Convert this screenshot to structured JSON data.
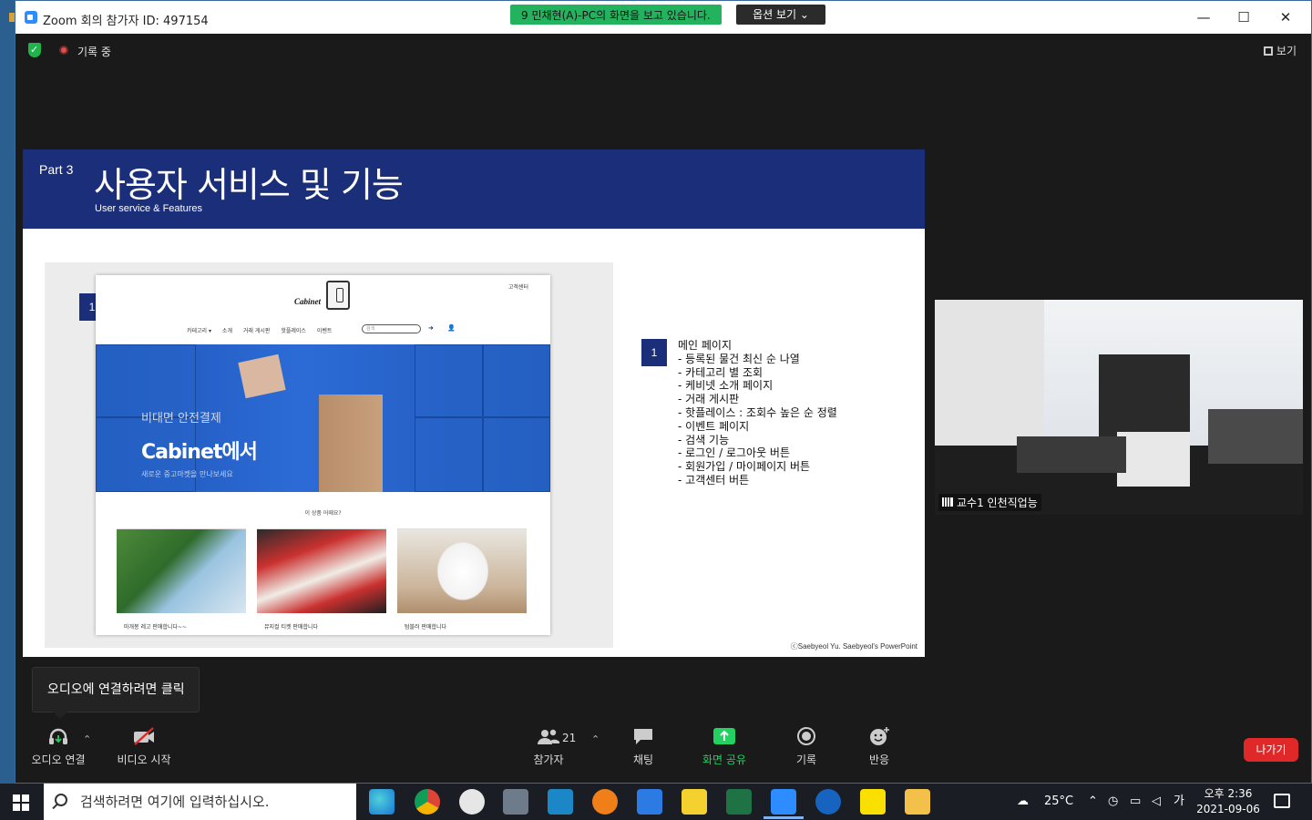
{
  "window": {
    "title": "Zoom 회의 참가자 ID: 497154",
    "minimize": "—",
    "maximize": "☐",
    "close": "✕"
  },
  "share_banner": {
    "text": "9 민채현(A)-PC의 화면을 보고 있습니다.",
    "options_label": "옵션 보기 ⌄"
  },
  "meeting_status": {
    "recording_label": "기록 중",
    "view_label": "보기"
  },
  "slide": {
    "part": "Part 3",
    "title": "사용자 서비스 및 기능",
    "subtitle": "User service & Features",
    "badge": "1",
    "copyright": "ⓒSaebyeol Yu. Saebyeol's PowerPoint",
    "site": {
      "customer_center": "고객센터",
      "logo": "Cabinet",
      "nav": [
        "카테고리 ▾",
        "소개",
        "거래 게시판",
        "핫플레이스",
        "이벤트"
      ],
      "search_placeholder": "검색",
      "hero_line1": "비대면 안전결제",
      "hero_line2": "Cabinet에서",
      "hero_line3": "새로운 중고마켓을 만나보세요",
      "recommend_title": "이 상품 어때요?",
      "products": [
        {
          "caption": "마개봉 레고 판매합니다~~"
        },
        {
          "caption": "뮤지컬 티켓 판매합니다"
        },
        {
          "caption": "텀블러 판매합니다"
        }
      ]
    },
    "description": {
      "heading": "메인 페이지",
      "items": [
        "등록된 물건 최신 순 나열",
        "카테고리 별 조회",
        "케비넷 소개 페이지",
        "거래 게시판",
        "핫플레이스 : 조회수 높은 순 정렬",
        "이벤트 페이지",
        "검색 기능",
        "로그인 / 로그아웃 버튼",
        "회원가입 / 마이페이지 버튼",
        "고객센터 버튼"
      ]
    }
  },
  "video": {
    "participant_name": "교수1 인천직업능"
  },
  "tooltip": {
    "text": "오디오에 연결하려면 클릭"
  },
  "toolbar": {
    "audio": "오디오 연결",
    "video": "비디오 시작",
    "participants": "참가자",
    "participants_count": "21",
    "chat": "채팅",
    "share": "화면 공유",
    "record": "기록",
    "reactions": "반응",
    "leave": "나가기",
    "share_color": "#23d160",
    "leave_color": "#e02828"
  },
  "taskbar": {
    "search_placeholder": "검색하려면 여기에 입력하십시오.",
    "weather": "25°C",
    "ime": "가",
    "time": "오후 2:36",
    "date": "2021-09-06"
  }
}
